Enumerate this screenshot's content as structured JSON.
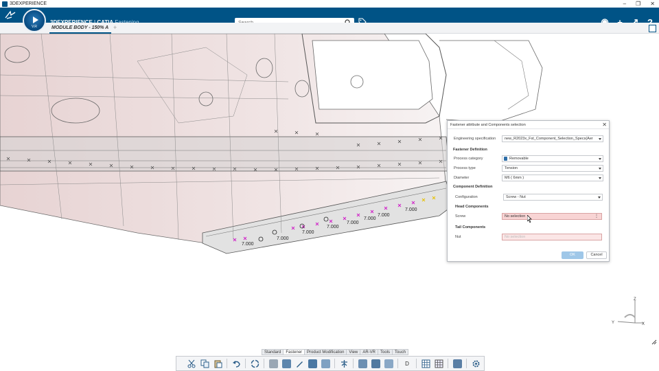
{
  "os": {
    "title": "3DEXPERIENCE",
    "controls": [
      "–",
      "❐",
      "✕"
    ]
  },
  "app": {
    "brand_bold": "3DEXPERIENCE",
    "brand_sep": " | ",
    "brand_product": "CATIA",
    "brand_app": " Fastening",
    "version": "V.R",
    "search_placeholder": "Search",
    "icons": [
      "user-icon",
      "plus-icon",
      "share-icon",
      "help-icon"
    ],
    "icon_glyphs": [
      "◉",
      "+",
      "↗",
      "?"
    ]
  },
  "tabs": {
    "active": "MODULE BODY - 150% A",
    "add": "+"
  },
  "viewport": {
    "dimension_labels": [
      "7.000",
      "7.000",
      "7.000",
      "7.000",
      "7.000",
      "7.000",
      "7.000",
      "7.000"
    ],
    "axis": {
      "z": "Z",
      "y": "Y",
      "x": "X"
    }
  },
  "dialog": {
    "title": "Fastener attribute and Components selection",
    "engineering_spec_label": "Engineering specification",
    "engineering_spec_value": "new_R2023x_Fst_Component_Selection_Specs(Aer",
    "fastener_definition": "Fastener Definition",
    "process_category_label": "Process category",
    "process_category_value": "Removable",
    "process_type_label": "Process type",
    "process_type_value": "Tension",
    "diameter_label": "Diameter",
    "diameter_value": "M6 ( 6mm )",
    "component_definition": "Component Definition",
    "configuration_label": "Configuration",
    "configuration_value": "Screw - Nut",
    "head_components": "Head Components",
    "screw_label": "Screw",
    "screw_value": "No selection",
    "tail_components": "Tail Components",
    "nut_label": "Nut",
    "nut_value": "No selection",
    "ok": "OK",
    "cancel": "Cancel"
  },
  "toolbar": {
    "tabs": [
      "Standard",
      "Fastener",
      "Product Modification",
      "View",
      "AR-VR",
      "Tools",
      "Touch"
    ],
    "active_tab": "Fastener",
    "tools": [
      "cut-icon",
      "copy-icon",
      "paste-icon",
      "undo-icon",
      "update-icon",
      "fastener-icon",
      "fastener-point-icon",
      "pencil-icon",
      "fastener-set-icon",
      "fastener-check-icon",
      "pin-icon",
      "group-icon",
      "split-icon",
      "align-icon",
      "d-icon",
      "table-icon",
      "grid-icon",
      "tree-icon",
      "settings-icon"
    ]
  },
  "colors": {
    "brand_blue": "#005386",
    "dialog_pink": "#f8d4d4",
    "ok_button": "#9fc7e8",
    "fastener_magenta": "#d020c8"
  }
}
